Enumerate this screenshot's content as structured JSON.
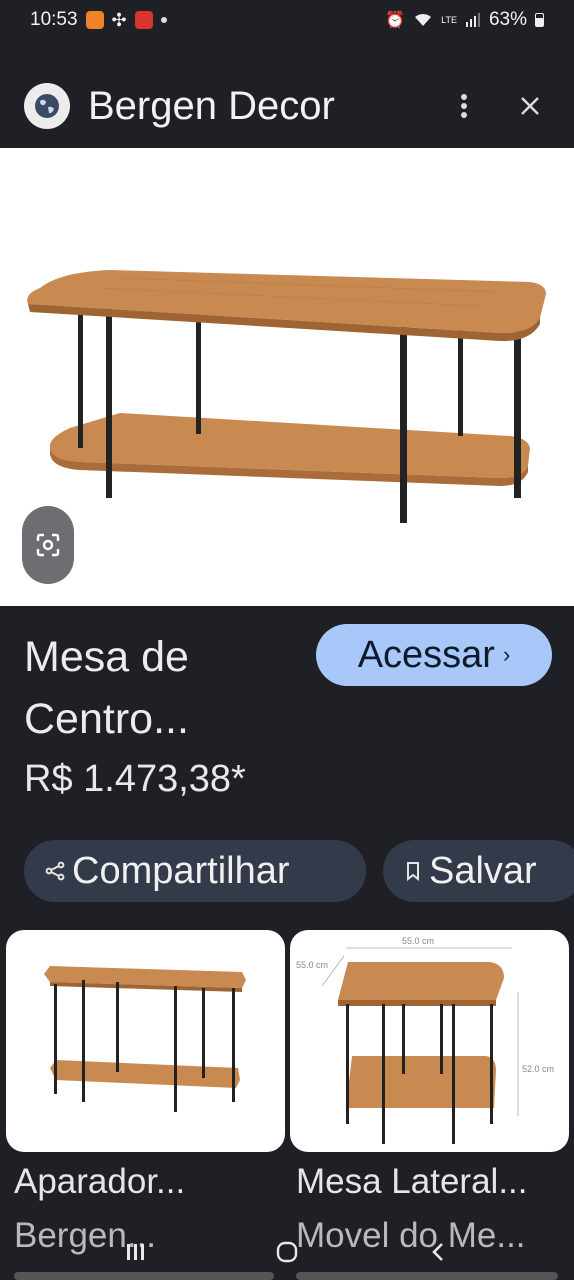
{
  "status_bar": {
    "time": "10:53",
    "battery": "63%",
    "network": "LTE"
  },
  "header": {
    "site_name": "Bergen Decor"
  },
  "product": {
    "title": "Mesa de Centro...",
    "price": "R$ 1.473,38*",
    "visit_label": "Acessar"
  },
  "actions": {
    "share_label": "Compartilhar",
    "save_label": "Salvar"
  },
  "related": [
    {
      "title": "Aparador...",
      "source": "Bergen..."
    },
    {
      "title": "Mesa Lateral...",
      "source": "Movel do Me..."
    }
  ],
  "dimension_labels": {
    "width": "55.0 cm",
    "depth": "55.0 cm",
    "height": "52.0 cm"
  },
  "colors": {
    "background": "#1f2025",
    "accent_button": "#a8c8fa",
    "pill_background": "#333a4a",
    "wood": "#c98a52"
  }
}
